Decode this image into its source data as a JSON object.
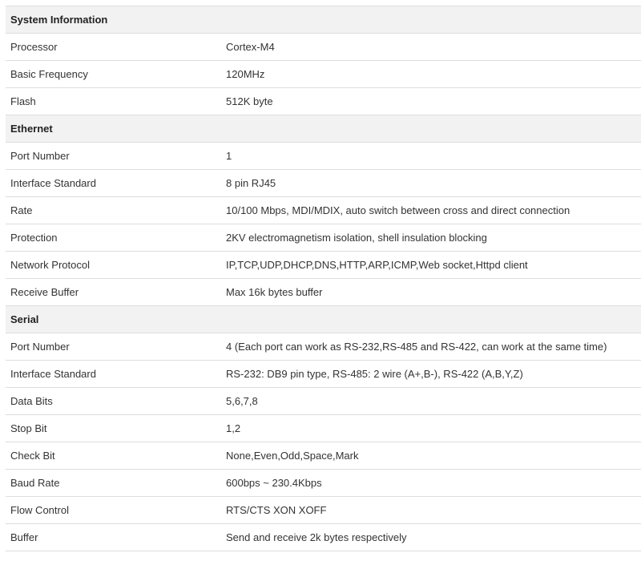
{
  "sections": [
    {
      "title": "System Information",
      "rows": [
        {
          "label": "Processor",
          "value": "Cortex-M4"
        },
        {
          "label": "Basic Frequency",
          "value": "120MHz"
        },
        {
          "label": "Flash",
          "value": "512K byte"
        }
      ]
    },
    {
      "title": "Ethernet",
      "rows": [
        {
          "label": "Port Number",
          "value": "1"
        },
        {
          "label": "Interface Standard",
          "value": "8 pin RJ45"
        },
        {
          "label": "Rate",
          "value": "10/100 Mbps, MDI/MDIX, auto switch between cross and direct connection"
        },
        {
          "label": "Protection",
          "value": "2KV electromagnetism isolation, shell insulation blocking"
        },
        {
          "label": "Network Protocol",
          "value": "IP,TCP,UDP,DHCP,DNS,HTTP,ARP,ICMP,Web socket,Httpd client"
        },
        {
          "label": "Receive Buffer",
          "value": "Max 16k bytes buffer"
        }
      ]
    },
    {
      "title": "Serial",
      "rows": [
        {
          "label": "Port Number",
          "value": "4 (Each port can work as RS-232,RS-485 and RS-422, can work at the same time)"
        },
        {
          "label": "Interface Standard",
          "value": "RS-232: DB9 pin type, RS-485: 2 wire (A+,B-), RS-422 (A,B,Y,Z)"
        },
        {
          "label": "Data Bits",
          "value": "5,6,7,8"
        },
        {
          "label": "Stop Bit",
          "value": "1,2"
        },
        {
          "label": "Check Bit",
          "value": "None,Even,Odd,Space,Mark"
        },
        {
          "label": "Baud Rate",
          "value": "600bps ~ 230.4Kbps"
        },
        {
          "label": "Flow Control",
          "value": "RTS/CTS XON XOFF"
        },
        {
          "label": "Buffer",
          "value": "Send and receive 2k bytes respectively"
        }
      ]
    }
  ]
}
